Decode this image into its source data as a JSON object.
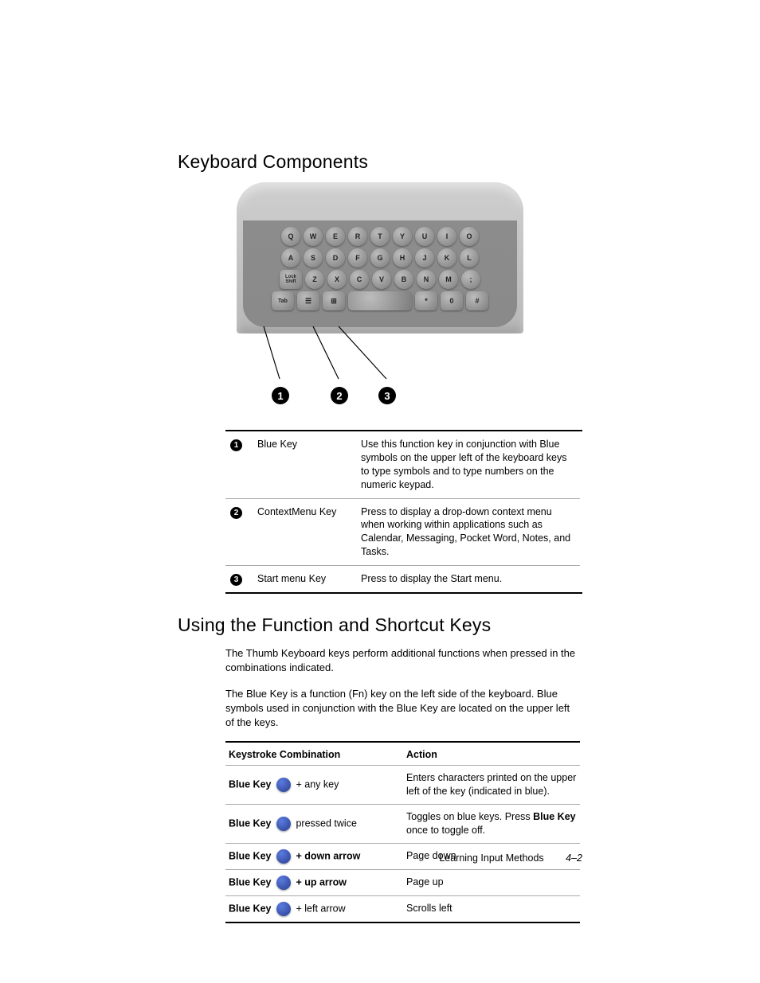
{
  "headings": {
    "keyboard_components": "Keyboard Components",
    "using_fn_shortcut": "Using the Function and Shortcut Keys"
  },
  "component_table": {
    "rows": [
      {
        "num": "1",
        "name": "Blue Key",
        "desc": "Use this function key in conjunction with Blue symbols on the upper left of the keyboard keys to type symbols and to type numbers on the numeric keypad."
      },
      {
        "num": "2",
        "name": "ContextMenu Key",
        "desc": "Press to display a drop-down context menu when working within applications such as Calendar, Messaging, Pocket Word, Notes, and Tasks."
      },
      {
        "num": "3",
        "name": "Start menu Key",
        "desc": "Press to display the Start menu."
      }
    ]
  },
  "paragraphs": {
    "p1": "The Thumb Keyboard keys perform additional functions when pressed in the combinations indicated.",
    "p2": "The Blue Key is a function (Fn) key on the left side of the keyboard. Blue symbols used in conjunction with the Blue Key are located on the upper left of the keys."
  },
  "shortcut_table": {
    "head": {
      "c1": "Keystroke Combination",
      "c2": "Action"
    },
    "blue_key_label": "Blue Key",
    "rows": [
      {
        "suffix": " + any key",
        "suffix_bold": false,
        "action_pre": "Enters characters printed on the upper left of the key (indicated in blue).",
        "action_bold": "",
        "action_post": ""
      },
      {
        "suffix": " pressed twice",
        "suffix_bold": false,
        "action_pre": "Toggles on blue keys. Press ",
        "action_bold": "Blue Key",
        "action_post": " once to toggle off."
      },
      {
        "suffix": " + down arrow",
        "suffix_bold": true,
        "action_pre": "Page down",
        "action_bold": "",
        "action_post": ""
      },
      {
        "suffix": " + up arrow",
        "suffix_bold": true,
        "action_pre": "Page up",
        "action_bold": "",
        "action_post": ""
      },
      {
        "suffix": " + left arrow",
        "suffix_bold": false,
        "action_pre": "Scrolls left",
        "action_bold": "",
        "action_post": ""
      }
    ]
  },
  "footer": {
    "section": "Learning Input Methods",
    "page": "4–2"
  }
}
